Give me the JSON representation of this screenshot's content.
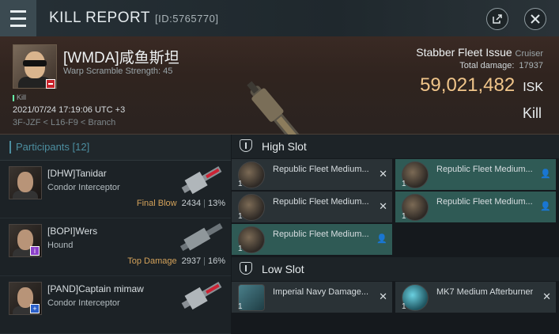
{
  "header": {
    "title": "KILL REPORT",
    "id_label": "[ID:5765770]",
    "share_icon": "share-icon",
    "close_icon": "close-icon"
  },
  "victim": {
    "name": "[WMDA]咸鱼斯坦",
    "warp_scramble": "Warp Scramble Strength: 45",
    "kill_tag": "Kill",
    "datetime": "2021/07/24 17:19:06 UTC +3",
    "location": "3F-JZF < L16-F9 < Branch",
    "ship_name": "Stabber Fleet Issue",
    "ship_class": "Cruiser",
    "total_damage_label": "Total damage:",
    "total_damage": "17937",
    "isk_value": "59,021,482",
    "isk_unit": "ISK",
    "kill_type": "Kill"
  },
  "participants": {
    "header": "Participants [12]",
    "rows": [
      {
        "name": "[DHW]Tanidar",
        "ship": "Condor Interceptor",
        "label": "Final Blow",
        "damage": "2434",
        "percent": "13%",
        "badge": "",
        "badge_color": ""
      },
      {
        "name": "[BOPI]Wers",
        "ship": "Hound",
        "label": "Top Damage",
        "damage": "2937",
        "percent": "16%",
        "badge": "i",
        "badge_color": "#8a3fc9"
      },
      {
        "name": "[PAND]Captain mimaw",
        "ship": "Condor Interceptor",
        "label": "",
        "damage": "",
        "percent": "",
        "badge": "+",
        "badge_color": "#2a5fc9"
      }
    ]
  },
  "slots": {
    "high_slot_label": "High Slot",
    "low_slot_label": "Low Slot",
    "high": [
      {
        "name": "Republic Fleet Medium...",
        "qty": "1",
        "status": "destroyed"
      },
      {
        "name": "Republic Fleet Medium...",
        "qty": "1",
        "status": "dropped"
      },
      {
        "name": "Republic Fleet Medium...",
        "qty": "1",
        "status": "destroyed"
      },
      {
        "name": "Republic Fleet Medium...",
        "qty": "1",
        "status": "dropped"
      },
      {
        "name": "Republic Fleet Medium...",
        "qty": "1",
        "status": "dropped"
      }
    ],
    "low": [
      {
        "name": "Imperial Navy Damage...",
        "qty": "1",
        "status": "destroyed"
      },
      {
        "name": "MK7 Medium Afterburner",
        "qty": "1",
        "status": "destroyed"
      }
    ]
  },
  "colors": {
    "isk": "#f0c58a",
    "dropped_bg": "#2f5a55",
    "destroyed_bg": "#2a3236",
    "accent": "#4c8ea0"
  }
}
